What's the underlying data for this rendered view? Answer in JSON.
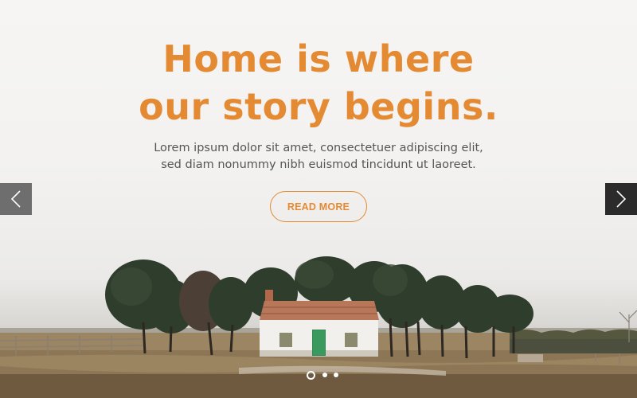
{
  "hero": {
    "headline_line1": "Home is where",
    "headline_line2": "our story begins.",
    "description_line1": "Lorem ipsum dolor sit amet, consectetuer adipiscing elit,",
    "description_line2": "sed diam nonummy nibh euismod tincidunt ut laoreet.",
    "cta_label": "READ MORE"
  },
  "slider": {
    "prev_icon": "chevron-left-icon",
    "next_icon": "chevron-right-icon",
    "dots": [
      "active",
      "inactive",
      "inactive"
    ]
  },
  "colors": {
    "accent": "#e48a33",
    "text": "#555555",
    "arrow_prev_bg": "#6e6e6e",
    "arrow_next_bg": "#2b2b2b"
  }
}
